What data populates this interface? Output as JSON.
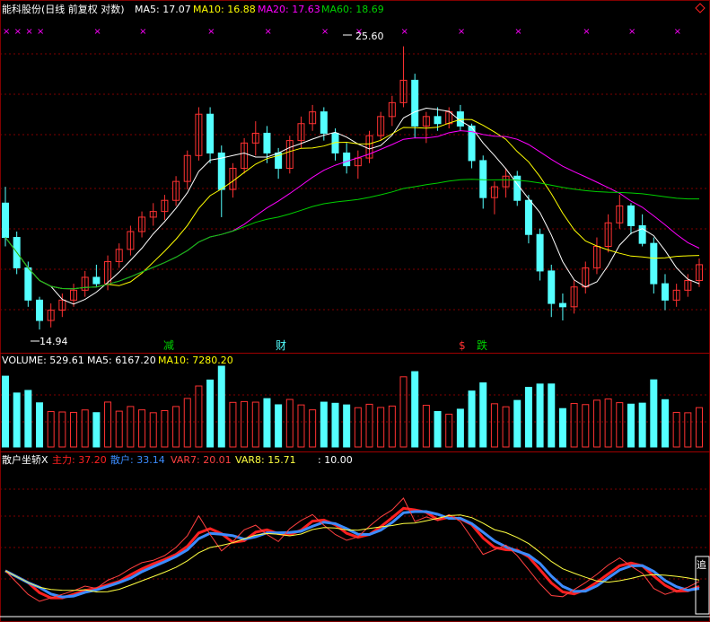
{
  "header": {
    "title": "能科股份(日线 前复权 对数)",
    "ma5": "MA5: 17.07",
    "ma10": "MA10: 16.88",
    "ma20": "MA20: 17.63",
    "ma60": "MA60: 18.69"
  },
  "volume_header": {
    "label": "VOLUME: 529.61",
    "ma5": "MA5: 6167.20",
    "ma10": "MA10: 7280.20"
  },
  "indicator_header": {
    "name": "散户坐轿X",
    "zhuli": "主力: 37.20",
    "sanhu": "散户: 33.14",
    "var7": "VAR7: 20.01",
    "var8": "VAR8: 15.71",
    "extra": ": 10.00"
  },
  "annotations": {
    "high_label": "25.60",
    "low_label": "14.94",
    "event_jian": "减",
    "event_cai": "财",
    "event_s": "$",
    "event_die": "跌",
    "right_edge_label": "追"
  },
  "colors": {
    "up": "#ff3232",
    "down": "#54ffff",
    "ma5": "#ffffff",
    "ma10": "#ffff00",
    "ma20": "#ff00ff",
    "ma60": "#00d000",
    "grid": "#800000",
    "zhuli": "#ff2020",
    "sanhu": "#3c8cff",
    "var7": "#ff4040",
    "var8": "#ffff40"
  },
  "chart_data": {
    "type": "candlestick",
    "price_range": [
      14.94,
      25.6
    ],
    "candles": [
      [
        19.0,
        19.6,
        17.5,
        17.8
      ],
      [
        17.8,
        18.0,
        16.6,
        16.8
      ],
      [
        16.8,
        17.0,
        15.6,
        15.8
      ],
      [
        15.8,
        15.9,
        14.94,
        15.2
      ],
      [
        15.2,
        15.7,
        15.0,
        15.5
      ],
      [
        15.5,
        16.0,
        15.3,
        15.8
      ],
      [
        15.8,
        16.3,
        15.6,
        16.1
      ],
      [
        16.1,
        16.7,
        15.9,
        16.5
      ],
      [
        16.5,
        16.9,
        16.2,
        16.3
      ],
      [
        16.3,
        17.2,
        16.1,
        17.0
      ],
      [
        17.0,
        17.6,
        16.8,
        17.4
      ],
      [
        17.4,
        18.2,
        17.2,
        18.0
      ],
      [
        18.0,
        18.7,
        17.8,
        18.5
      ],
      [
        18.5,
        19.0,
        18.2,
        18.7
      ],
      [
        18.7,
        19.3,
        18.4,
        19.1
      ],
      [
        19.1,
        20.0,
        18.9,
        19.8
      ],
      [
        19.8,
        21.0,
        19.5,
        20.8
      ],
      [
        20.8,
        22.8,
        20.6,
        22.5
      ],
      [
        22.5,
        22.8,
        20.5,
        20.9
      ],
      [
        20.9,
        21.2,
        18.5,
        19.5
      ],
      [
        19.5,
        20.5,
        19.2,
        20.3
      ],
      [
        20.3,
        21.5,
        20.1,
        21.3
      ],
      [
        21.3,
        22.2,
        20.8,
        21.7
      ],
      [
        21.7,
        22.0,
        20.5,
        20.9
      ],
      [
        20.9,
        21.1,
        19.9,
        20.3
      ],
      [
        20.3,
        21.6,
        20.1,
        21.4
      ],
      [
        21.4,
        22.4,
        21.1,
        22.1
      ],
      [
        22.1,
        22.9,
        21.8,
        22.6
      ],
      [
        22.6,
        22.8,
        21.4,
        21.7
      ],
      [
        21.7,
        21.9,
        20.6,
        20.9
      ],
      [
        20.9,
        21.3,
        20.1,
        20.4
      ],
      [
        20.4,
        21.0,
        19.9,
        20.7
      ],
      [
        20.7,
        21.8,
        20.5,
        21.6
      ],
      [
        21.6,
        22.6,
        21.4,
        22.4
      ],
      [
        22.4,
        23.3,
        22.0,
        23.0
      ],
      [
        23.0,
        25.6,
        22.8,
        24.0
      ],
      [
        24.0,
        24.3,
        21.5,
        22.0
      ],
      [
        22.0,
        22.6,
        21.3,
        22.4
      ],
      [
        22.4,
        22.8,
        21.8,
        22.1
      ],
      [
        22.1,
        22.8,
        21.9,
        22.6
      ],
      [
        22.6,
        22.9,
        21.8,
        22.0
      ],
      [
        22.0,
        22.1,
        20.3,
        20.6
      ],
      [
        20.6,
        20.8,
        18.8,
        19.2
      ],
      [
        19.2,
        19.8,
        18.6,
        19.6
      ],
      [
        19.6,
        20.3,
        19.2,
        20.0
      ],
      [
        20.0,
        20.2,
        18.9,
        19.1
      ],
      [
        19.1,
        19.3,
        17.6,
        17.9
      ],
      [
        17.9,
        18.1,
        16.4,
        16.7
      ],
      [
        16.7,
        16.9,
        15.3,
        15.7
      ],
      [
        15.7,
        16.0,
        15.2,
        15.6
      ],
      [
        15.6,
        16.4,
        15.4,
        16.2
      ],
      [
        16.2,
        17.0,
        16.0,
        16.8
      ],
      [
        16.8,
        17.8,
        16.6,
        17.5
      ],
      [
        17.5,
        18.6,
        17.3,
        18.3
      ],
      [
        18.3,
        19.3,
        18.1,
        18.9
      ],
      [
        18.9,
        19.0,
        17.9,
        18.2
      ],
      [
        18.2,
        18.6,
        17.5,
        17.6
      ],
      [
        17.6,
        17.8,
        16.0,
        16.3
      ],
      [
        16.3,
        16.6,
        15.5,
        15.8
      ],
      [
        15.8,
        16.3,
        15.6,
        16.1
      ],
      [
        16.1,
        16.6,
        15.9,
        16.4
      ],
      [
        16.4,
        17.1,
        16.2,
        16.9
      ]
    ]
  }
}
